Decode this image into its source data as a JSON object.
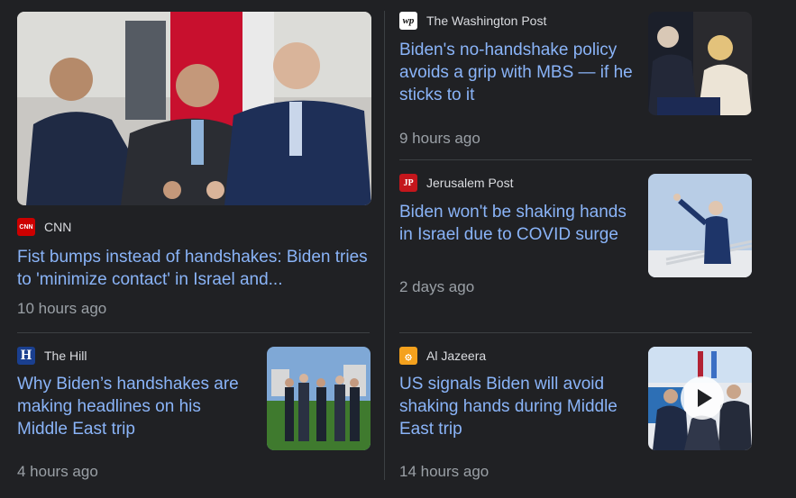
{
  "stories": {
    "cnn": {
      "source": "CNN",
      "logo_text": "CNN",
      "logo_color": "#cc0000",
      "headline": "Fist bumps instead of handshakes: Biden tries to 'minimize contact' in Israel and...",
      "age": "10 hours ago"
    },
    "hill": {
      "source": "The Hill",
      "logo_text": "H",
      "logo_color": "#1a3f8f",
      "headline": "Why Biden’s handshakes are making headlines on his Middle East trip",
      "age": "4 hours ago"
    },
    "wapo": {
      "source": "The Washington Post",
      "logo_text": "wp",
      "logo_color": "#ffffff",
      "headline": "Biden's no-handshake policy avoids a grip with MBS — if he sticks to it",
      "age": "9 hours ago"
    },
    "jpost": {
      "source": "Jerusalem Post",
      "logo_text": "JP",
      "logo_color": "#c4161c",
      "headline": "Biden won't be shaking hands in Israel due to COVID surge",
      "age": "2 days ago"
    },
    "aljazeera": {
      "source": "Al Jazeera",
      "logo_text": "۞",
      "logo_color": "#f4a11d",
      "headline": "US signals Biden will avoid shaking hands during Middle East trip",
      "age": "14 hours ago"
    }
  }
}
